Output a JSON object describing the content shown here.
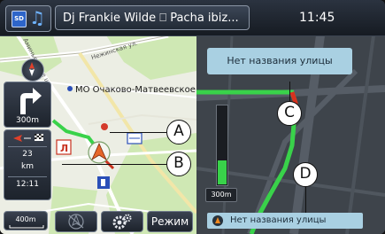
{
  "topbar": {
    "media_sd_label": "SD",
    "track_title": "Dj Frankie Wilde  ⎕ Pacha ibiz...",
    "clock": "11:45"
  },
  "left_map": {
    "poi_label": "МО Очаково-Матвеевское",
    "street_labels": [
      "Нежинская ул.",
      "Аминьевское ш."
    ]
  },
  "left_panel": {
    "turn_distance": "300m",
    "remaining_distance": "23",
    "remaining_unit": "km",
    "eta": "12:11",
    "scale": "400m"
  },
  "bottom_buttons": {
    "mode_label": "Режим"
  },
  "right_view": {
    "street_top": "Нет названия улицы",
    "street_bottom": "Нет названия улицы",
    "distance_label": "300m",
    "distance_progress": 0.3
  },
  "callouts": [
    "A",
    "B",
    "C",
    "D"
  ],
  "colors": {
    "route": "#39d24a",
    "street_banner": "#a9d0e2",
    "maneuver_icon": "#f08a20"
  }
}
